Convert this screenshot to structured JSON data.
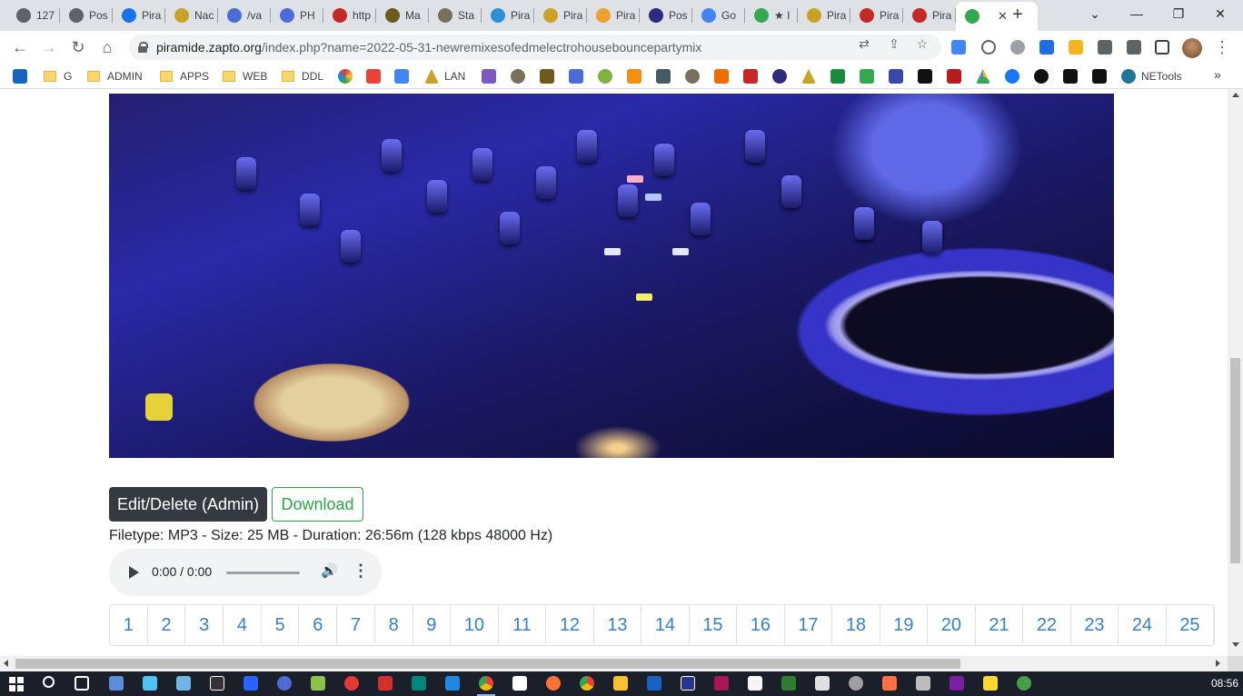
{
  "browser": {
    "tabs": [
      {
        "title": "127",
        "color": "#5f6368"
      },
      {
        "title": "Pos",
        "color": "#5f6368"
      },
      {
        "title": "Pira",
        "color": "#1a73e8"
      },
      {
        "title": "Nac",
        "color": "#c9a227"
      },
      {
        "title": "/va",
        "color": "#4a6cd4"
      },
      {
        "title": "PH",
        "color": "#4a6cd4"
      },
      {
        "title": "http",
        "color": "#c62828"
      },
      {
        "title": "Ma",
        "color": "#6d5a1c"
      },
      {
        "title": "Sta",
        "color": "#77705a"
      },
      {
        "title": "Pira",
        "color": "#2e8fd6"
      },
      {
        "title": "Pira",
        "color": "#c9a227"
      },
      {
        "title": "Pira",
        "color": "#f0a030"
      },
      {
        "title": "Pos",
        "color": "#2d2a80"
      },
      {
        "title": "Go",
        "color": "#4285f4"
      },
      {
        "title": "★ I",
        "color": "#34a853"
      },
      {
        "title": "Pira",
        "color": "#c9a227"
      },
      {
        "title": "Pira",
        "color": "#c62828"
      },
      {
        "title": "Pira",
        "color": "#c62828"
      },
      {
        "title": "",
        "color": "#34a853"
      }
    ],
    "active_tab_close": "✕",
    "new_tab": "+",
    "window_controls": {
      "dropdown": "⌄",
      "minimize": "—",
      "maximize": "❐",
      "close": "✕"
    },
    "url_host": "piramide.zapto.org",
    "url_path": "/index.php?name=2022-05-31-newremixesofedmelectrohousebouncepartymix",
    "bookmarks": [
      {
        "label": "",
        "kind": "icon",
        "color": "#1565c0"
      },
      {
        "label": "G",
        "kind": "folder"
      },
      {
        "label": "ADMIN",
        "kind": "folder"
      },
      {
        "label": "APPS",
        "kind": "folder"
      },
      {
        "label": "WEB",
        "kind": "folder"
      },
      {
        "label": "DDL",
        "kind": "folder"
      },
      {
        "label": "LAN",
        "kind": "icon",
        "color": "#c9a227"
      },
      {
        "label": "NETools",
        "kind": "icon",
        "color": "#21759b"
      }
    ],
    "bookmarks_more": "»"
  },
  "page": {
    "edit_button": "Edit/Delete (Admin)",
    "download_button": "Download",
    "file_info": "Filetype: MP3 - Size: 25 MB - Duration: 26:56m (128 kbps 48000 Hz)",
    "player": {
      "time": "0:00 / 0:00",
      "volume_icon": "🔊",
      "more_icon": "⋮"
    },
    "pages": [
      "1",
      "2",
      "3",
      "4",
      "5",
      "6",
      "7",
      "8",
      "9",
      "10",
      "11",
      "12",
      "13",
      "14",
      "15",
      "16",
      "17",
      "18",
      "19",
      "20",
      "21",
      "22",
      "23",
      "24",
      "25"
    ]
  },
  "taskbar": {
    "clock": "08:56"
  },
  "colors": {
    "accent_dark": "#343a40",
    "accent_green": "#28a745",
    "link_blue": "#3580c6"
  }
}
